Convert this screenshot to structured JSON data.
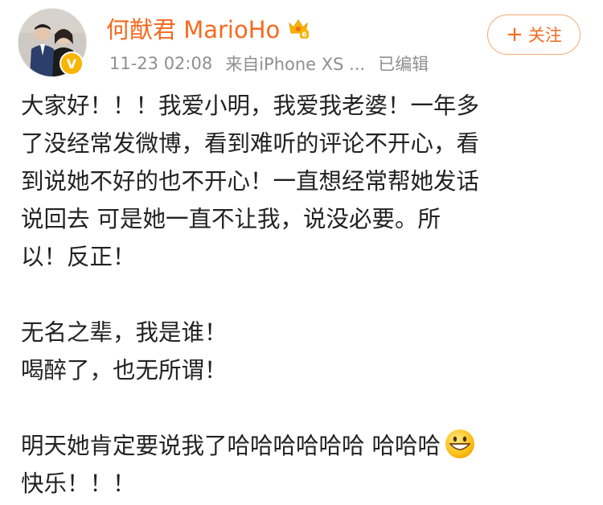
{
  "user": {
    "name": "何猷君 MarioHo",
    "avatar_icon": "profile-photo",
    "verified_icon": "orange-verified-v-icon",
    "verified_text": "V",
    "badge_icon": "crown-level-badge-icon"
  },
  "meta": {
    "timestamp": "11-23 02:08",
    "source": "来自iPhone XS ...",
    "edited": "已编辑"
  },
  "follow_button": {
    "plus": "+",
    "label": "关注"
  },
  "post": {
    "paragraph1_line1": "大家好！！！我爱小明，我爱我老婆！一年多",
    "paragraph1_line2": "了没经常发微博，看到难听的评论不开心，看",
    "paragraph1_line3": "到说她不好的也不开心！一直想经常帮她发话",
    "paragraph1_line4": "说回去 可是她一直不让我，说没必要。所",
    "paragraph1_line5": "以！反正！",
    "paragraph2_line1": "无名之辈，我是谁！",
    "paragraph2_line2": "喝醉了，也无所谓！",
    "paragraph3_line1": "明天她肯定要说我了哈哈哈哈哈哈 哈哈哈",
    "paragraph3_emoji": "grinning-face-emoji",
    "paragraph3_line2": "快乐！！！"
  },
  "colors": {
    "username": "#f56a1e",
    "meta": "#8f8f8f",
    "follow_border": "#f6a86e",
    "verified": "#f7b500"
  }
}
